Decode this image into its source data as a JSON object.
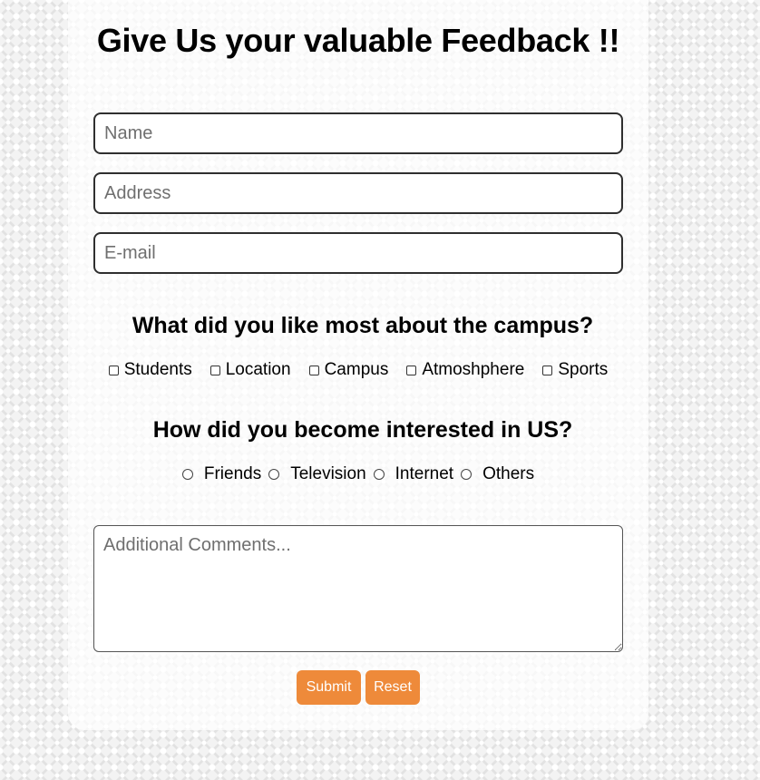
{
  "form": {
    "title": "Give Us your valuable Feedback !!",
    "fields": {
      "name_placeholder": "Name",
      "address_placeholder": "Address",
      "email_placeholder": "E-mail"
    },
    "question1": {
      "text": "What did you like most about the campus?",
      "options": [
        "Students",
        "Location",
        "Campus",
        "Atmoshphere",
        "Sports"
      ]
    },
    "question2": {
      "text": "How did you become interested in US?",
      "options": [
        "Friends",
        "Television",
        "Internet",
        "Others"
      ]
    },
    "comments_placeholder": "Additional Comments...",
    "buttons": {
      "submit": "Submit",
      "reset": "Reset"
    }
  },
  "colors": {
    "button_bg": "#ee8a3a",
    "button_text": "#ffffff",
    "page_bg": "#f3f3f3"
  }
}
